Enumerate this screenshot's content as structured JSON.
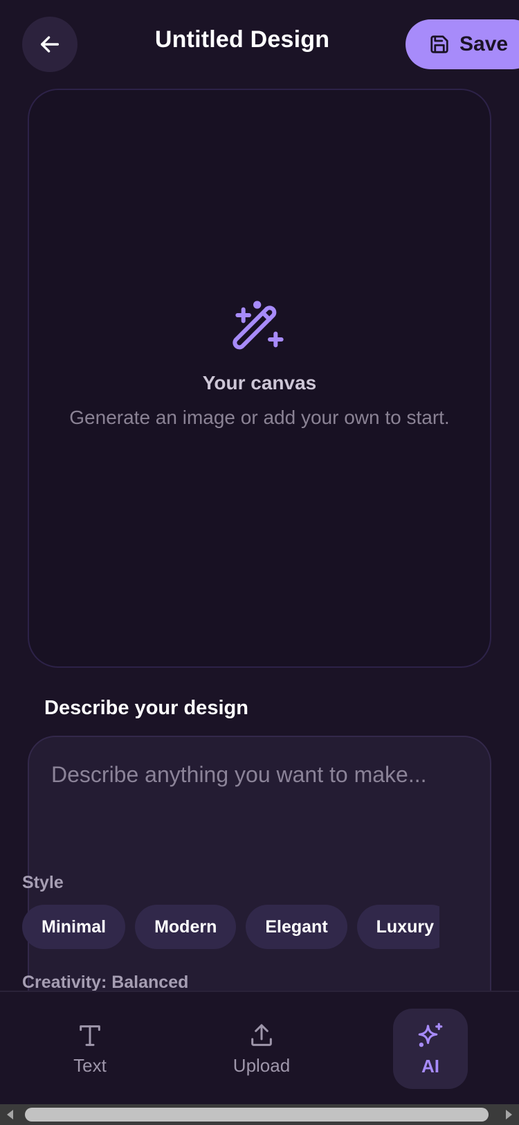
{
  "header": {
    "title": "Untitled Design",
    "back_icon": "arrow-left-icon",
    "save_label": "Save",
    "save_icon": "floppy-disk-icon"
  },
  "canvas": {
    "icon": "magic-wand-icon",
    "title": "Your canvas",
    "subtitle": "Generate an image or add your own to start."
  },
  "describe": {
    "label": "Describe your design",
    "placeholder": "Describe anything you want to make...",
    "style_label": "Style",
    "styles": [
      "Minimal",
      "Modern",
      "Elegant",
      "Luxury"
    ],
    "creativity_label": "Creativity: Balanced"
  },
  "bottom_nav": {
    "items": [
      {
        "label": "Text",
        "icon": "text-icon"
      },
      {
        "label": "Upload",
        "icon": "upload-icon"
      },
      {
        "label": "AI",
        "icon": "sparkle-icon",
        "active": true
      }
    ]
  },
  "colors": {
    "background": "#1b1326",
    "accent": "#a78bfa",
    "card": "#241c33",
    "chip": "#31284a"
  }
}
